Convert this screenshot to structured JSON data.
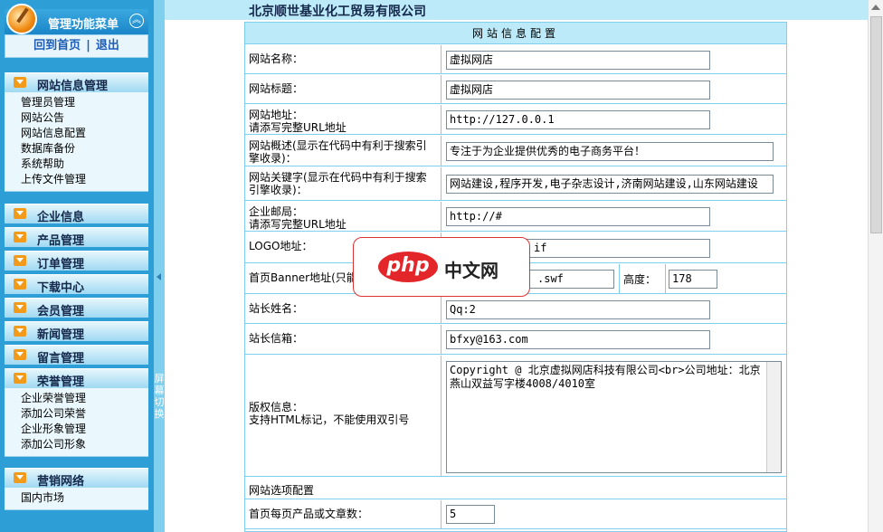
{
  "sidebar": {
    "title": "管理功能菜单",
    "top_links": [
      "回到首页",
      "退出"
    ],
    "groups": [
      {
        "title": "网站信息管理",
        "items": [
          "管理员管理",
          "网站公告",
          "网站信息配置",
          "数据库备份",
          "系统帮助",
          "上传文件管理"
        ]
      },
      {
        "title": "企业信息",
        "items": []
      },
      {
        "title": "产品管理",
        "items": []
      },
      {
        "title": "订单管理",
        "items": []
      },
      {
        "title": "下载中心",
        "items": []
      },
      {
        "title": "会员管理",
        "items": []
      },
      {
        "title": "新闻管理",
        "items": []
      },
      {
        "title": "留言管理",
        "items": []
      },
      {
        "title": "荣誉管理",
        "items": [
          "企业荣誉管理",
          "添加公司荣誉",
          "企业形象管理",
          "添加公司形象"
        ]
      },
      {
        "title": "营销网络",
        "items": [
          "国内市场"
        ]
      }
    ],
    "splitter_text": "屏幕切换"
  },
  "main": {
    "company": "北京顺世基业化工贸易有限公司",
    "form_title": "网站信息配置",
    "fields": {
      "site_name": {
        "label": "网站名称：",
        "value": "虚拟网店"
      },
      "site_title": {
        "label": "网站标题：",
        "value": "虚拟网店"
      },
      "site_url": {
        "label": "网站地址：",
        "label2": "请添写完整URL地址",
        "value": "http://127.0.0.1"
      },
      "site_desc": {
        "label": "网站概述(显示在代码中有利于搜索引擎收录)：",
        "value": "专注于为企业提供优秀的电子商务平台！"
      },
      "site_keywords": {
        "label": "网站关键字(显示在代码中有利于搜索引擎收录)：",
        "value": "网站建设,程序开发,电子杂志设计,济南网站建设,山东网站建设"
      },
      "mailbox": {
        "label": "企业邮局：",
        "label2": "请添写完整URL地址",
        "value": "http://#"
      },
      "logo": {
        "label": "LOGO地址：",
        "value": "if"
      },
      "banner": {
        "label": "首页Banner地址(只能",
        "value": ".swf",
        "height_label": "高度：",
        "height_value": "178"
      },
      "owner_name": {
        "label": "站长姓名：",
        "value": "Qq:2"
      },
      "owner_email": {
        "label": "站长信箱：",
        "value": "bfxy@163.com"
      },
      "copyright": {
        "label": "版权信息：",
        "label2": "支持HTML标记，不能使用双引号",
        "value": "Copyright @ 北京虚拟网店科技有限公司<br>公司地址：北京燕山双益写字楼4008/4010室"
      },
      "options_section": "网站选项配置",
      "per_page": {
        "label": "首页每页产品或文章数：",
        "value": "5"
      }
    }
  },
  "overlay": {
    "logo_text": "php",
    "cn_text": "中文网"
  }
}
